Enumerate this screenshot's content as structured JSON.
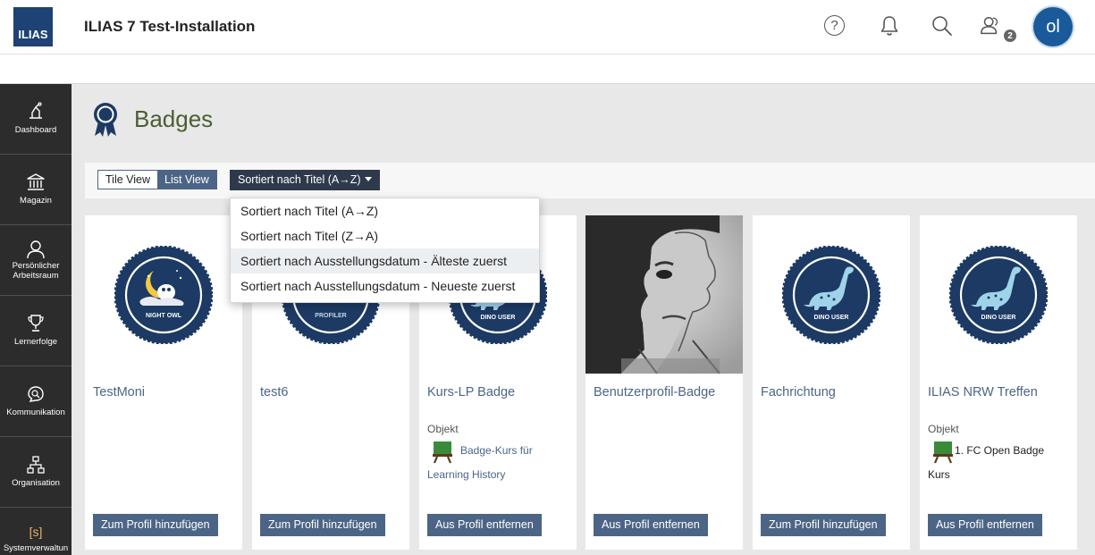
{
  "header": {
    "logo_text": "ILIAS",
    "title": "ILIAS 7 Test-Installation",
    "help_icon": "?",
    "users_count": "2",
    "avatar_initials": "ol",
    "icons": [
      "help-icon",
      "bell-icon",
      "search-icon",
      "users-icon"
    ]
  },
  "mainbar": {
    "items": [
      {
        "label": "Dashboard",
        "icon": "dashboard-icon"
      },
      {
        "label": "Magazin",
        "icon": "bank-icon"
      },
      {
        "label": "Persönlicher Arbeitsraum",
        "icon": "person-icon"
      },
      {
        "label": "Lernerfolge",
        "icon": "trophy-icon"
      },
      {
        "label": "Kommunikation",
        "icon": "chat-search-icon"
      },
      {
        "label": "Organisation",
        "icon": "org-chart-icon"
      },
      {
        "label": "Systemverwaltun",
        "icon": "admin-icon",
        "glyph": "[s]"
      }
    ]
  },
  "page": {
    "title": "Badges",
    "icon": "badge-ribbon-icon",
    "colors": {
      "title": "#4a5e33",
      "accent": "#4c6586",
      "dark_button": "#2e3a4c",
      "badge_navy": "#1c3a63"
    }
  },
  "toolbar": {
    "view_tile": "Tile View",
    "view_list": "List View",
    "active_view": "List View",
    "sort_label": "Sortiert nach Titel (A→Z)"
  },
  "sort_menu": {
    "items": [
      "Sortiert nach Titel (A→Z)",
      "Sortiert nach Titel (Z→A)",
      "Sortiert nach Ausstellungsdatum - Älteste zuerst",
      "Sortiert nach Ausstellungsdatum - Neueste zuerst"
    ],
    "highlighted_index": 2
  },
  "cards": [
    {
      "title": "TestMoni",
      "badge_text": "NIGHT OWL",
      "badge_type": "night-owl",
      "button": "Zum Profil hinzufügen"
    },
    {
      "title": "test6",
      "badge_text": "PROFILER",
      "badge_type": "profiler",
      "button": "Zum Profil hinzufügen"
    },
    {
      "title": "Kurs-LP Badge",
      "badge_text": "DINO USER",
      "badge_type": "dino",
      "button": "Aus Profil entfernen",
      "object_label": "Objekt",
      "object_line1": "Badge-Kurs für",
      "object_line2": "Learning History"
    },
    {
      "title": "Benutzerprofil-Badge",
      "badge_type": "photo",
      "button": "Aus Profil entfernen"
    },
    {
      "title": "Fachrichtung",
      "badge_text": "DINO USER",
      "badge_type": "dino",
      "button": "Zum Profil hinzufügen"
    },
    {
      "title": "ILIAS NRW Treffen",
      "badge_text": "DINO USER",
      "badge_type": "dino",
      "button": "Aus Profil entfernen",
      "object_label": "Objekt",
      "object_line1": "1. FC Open Badge",
      "object_line2": "Kurs"
    }
  ]
}
